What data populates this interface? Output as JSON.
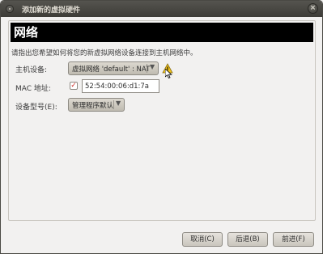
{
  "window": {
    "title": "添加新的虚拟硬件",
    "close_glyph": "×"
  },
  "page": {
    "heading": "网络",
    "description": "请指出您希望如何将您的新虚拟网络设备连接到主机网络中。"
  },
  "form": {
    "host_device": {
      "label": "主机设备:",
      "value": "虚拟网络 'default' : NAT"
    },
    "mac_address": {
      "label": "MAC 地址:",
      "checked": true,
      "value": "52:54:00:06:d1:7a"
    },
    "device_model": {
      "label": "设备型号(E):",
      "value": "管理程序默认"
    }
  },
  "icons": {
    "window_menu": "window-menu-icon",
    "close": "close-icon",
    "warning": "warning-icon",
    "dropdown": "chevron-down-icon"
  },
  "buttons": {
    "cancel": "取消(C)",
    "back": "后退(B)",
    "forward": "前进(F)"
  },
  "colors": {
    "banner_background": "#000000",
    "banner_text": "#ffffff",
    "warning": "#f0c31a",
    "checkbox_mark": "#d0322b"
  }
}
